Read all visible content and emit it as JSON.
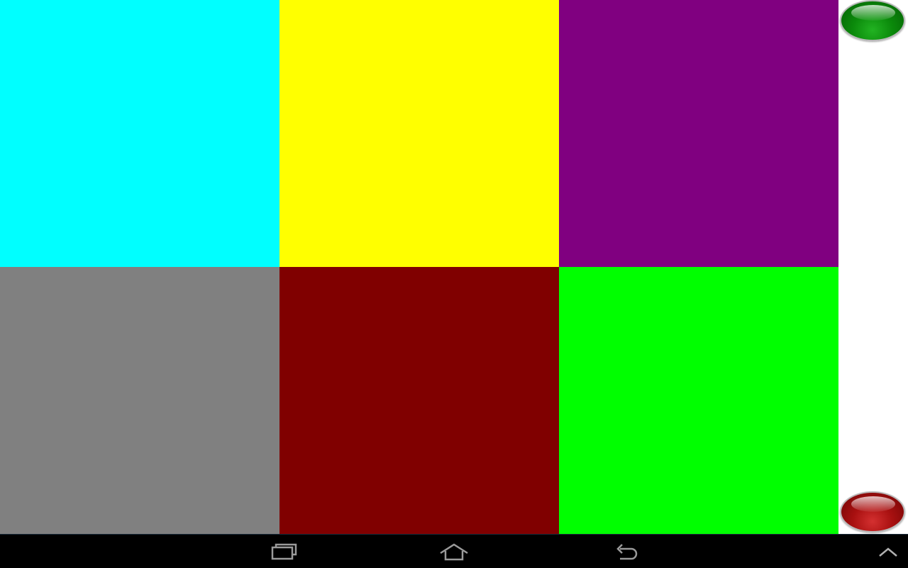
{
  "tiles": [
    {
      "name": "cyan",
      "color": "#00ffff"
    },
    {
      "name": "yellow",
      "color": "#ffff00"
    },
    {
      "name": "purple",
      "color": "#800080"
    },
    {
      "name": "gray",
      "color": "#808080"
    },
    {
      "name": "maroon",
      "color": "#800000"
    },
    {
      "name": "lime",
      "color": "#00ff00"
    }
  ],
  "side_buttons": {
    "top": {
      "icon": "green-orb-icon",
      "color": "#0b8a0b"
    },
    "bottom": {
      "icon": "red-orb-icon",
      "color": "#a81010"
    }
  },
  "nav_bar": {
    "background": "#000000",
    "icon_color": "#9a9a9a",
    "buttons": [
      "recents-icon",
      "home-icon",
      "back-icon",
      "menu-up-icon"
    ]
  }
}
